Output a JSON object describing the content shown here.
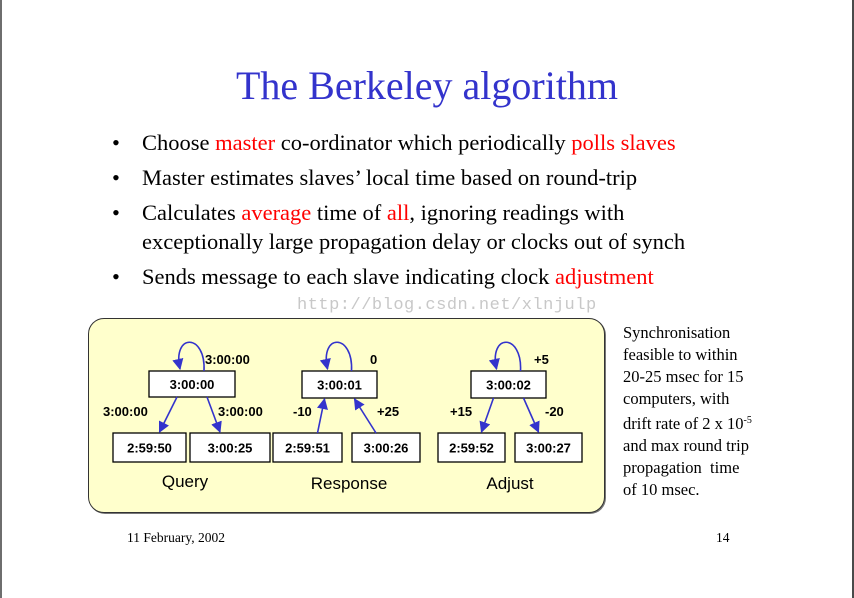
{
  "slide": {
    "title": "The Berkeley algorithm",
    "bullets": [
      {
        "parts": [
          {
            "text": "Choose ",
            "highlight": false
          },
          {
            "text": "master",
            "highlight": true
          },
          {
            "text": " co-ordinator which periodically ",
            "highlight": false
          },
          {
            "text": "polls slaves",
            "highlight": true
          }
        ]
      },
      {
        "parts": [
          {
            "text": "Master estimates slaves’ local time based on round-trip",
            "highlight": false
          }
        ]
      },
      {
        "parts": [
          {
            "text": "Calculates ",
            "highlight": false
          },
          {
            "text": "average",
            "highlight": true
          },
          {
            "text": " time of ",
            "highlight": false
          },
          {
            "text": "all",
            "highlight": true
          },
          {
            "text": ", ignoring readings with",
            "highlight": false
          },
          {
            "text": "\nexceptionally large propagation delay or clocks out of synch",
            "highlight": false
          }
        ]
      },
      {
        "parts": [
          {
            "text": "Sends message to each slave indicating clock ",
            "highlight": false
          },
          {
            "text": "adjustment",
            "highlight": true
          }
        ]
      }
    ],
    "bullet_glyph": "•",
    "colors": {
      "title": "#3333cc",
      "highlight": "#ff0000",
      "panel_fill": "#ffffcc",
      "arrow": "#3333cc"
    },
    "watermark": "http://blog.csdn.net/xlnjulp",
    "diagrams": [
      {
        "caption": "Query",
        "master": "3:00:00",
        "self_label": "3:00:00",
        "slaves": [
          "2:59:50",
          "3:00:25"
        ],
        "edge_labels": [
          "3:00:00",
          "3:00:00"
        ],
        "direction": "down"
      },
      {
        "caption": "Response",
        "master": "3:00:01",
        "self_label": "0",
        "slaves": [
          "2:59:51",
          "3:00:26"
        ],
        "edge_labels": [
          "-10",
          "+25"
        ],
        "direction": "up"
      },
      {
        "caption": "Adjust",
        "master": "3:00:02",
        "self_label": "+5",
        "slaves": [
          "2:59:52",
          "3:00:27"
        ],
        "edge_labels": [
          "+15",
          "-20"
        ],
        "direction": "down"
      }
    ],
    "side_note": {
      "lines": [
        "Synchronisation",
        "feasible to within",
        "20-25 msec for 15",
        "computers, with",
        "drift rate of 2 x 10",
        "and max round trip",
        "propagation  time",
        "of 10 msec."
      ],
      "exponent": "-5"
    },
    "footer": {
      "date": "11 February, 2002",
      "page_number": "14"
    }
  }
}
